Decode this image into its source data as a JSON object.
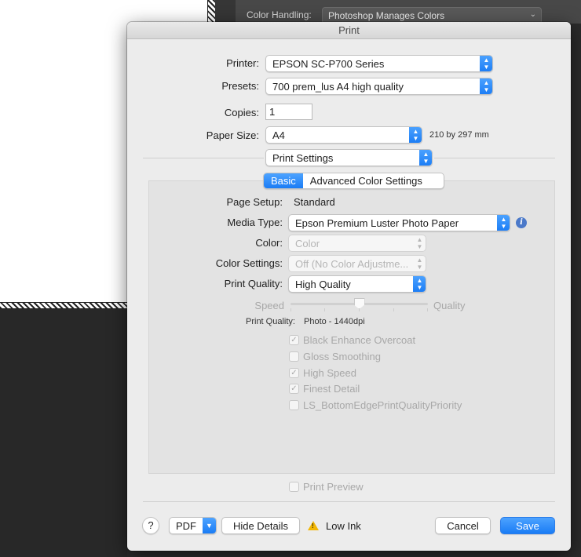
{
  "background": {
    "color_handling_label": "Color Handling:",
    "color_handling_value": "Photoshop Manages Colors"
  },
  "dialog": {
    "title": "Print",
    "printer": {
      "label": "Printer:",
      "value": "EPSON SC-P700 Series"
    },
    "presets": {
      "label": "Presets:",
      "value": "700 prem_lus A4 high quality"
    },
    "copies": {
      "label": "Copies:",
      "value": "1"
    },
    "paper_size": {
      "label": "Paper Size:",
      "value": "A4",
      "dimensions": "210 by 297 mm"
    },
    "section_popup": "Print Settings",
    "tabs": [
      {
        "label": "Basic",
        "active": true
      },
      {
        "label": "Advanced Color Settings",
        "active": false
      }
    ],
    "basic": {
      "page_setup": {
        "label": "Page Setup:",
        "value": "Standard"
      },
      "media_type": {
        "label": "Media Type:",
        "value": "Epson Premium Luster Photo Paper"
      },
      "color": {
        "label": "Color:",
        "value": "Color"
      },
      "color_settings": {
        "label": "Color Settings:",
        "value": "Off (No Color Adjustme..."
      },
      "print_quality": {
        "label": "Print Quality:",
        "value": "High Quality"
      },
      "slider": {
        "left_label": "Speed",
        "right_label": "Quality",
        "position": 0.5
      },
      "quality_readout": {
        "label": "Print Quality:",
        "value": "Photo - 1440dpi"
      },
      "options": [
        {
          "label": "Black Enhance Overcoat",
          "checked": true
        },
        {
          "label": "Gloss Smoothing",
          "checked": false
        },
        {
          "label": "High Speed",
          "checked": true
        },
        {
          "label": "Finest Detail",
          "checked": true
        },
        {
          "label": "LS_BottomEdgePrintQualityPriority",
          "checked": false
        }
      ]
    },
    "print_preview": {
      "label": "Print Preview",
      "checked": false
    },
    "footer": {
      "help": "?",
      "pdf": "PDF",
      "hide_details": "Hide Details",
      "low_ink": "Low Ink",
      "cancel": "Cancel",
      "save": "Save"
    }
  },
  "colors": {
    "accent": "#1a7cf5",
    "dialog_bg": "#ececec",
    "warning": "#f2b705"
  },
  "icons": [
    "chevron-updown-icon",
    "info-icon",
    "warning-icon",
    "checkmark-icon"
  ]
}
